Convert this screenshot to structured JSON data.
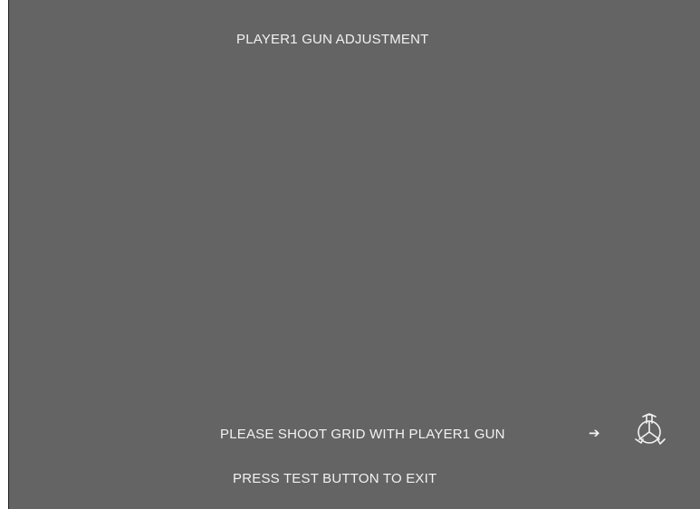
{
  "screen": {
    "title": "PLAYER1 GUN ADJUSTMENT",
    "instruction": "PLEASE SHOOT GRID WITH PLAYER1 GUN",
    "arrow": "➔",
    "exit_text": "PRESS TEST BUTTON TO EXIT",
    "icon": "gun-target-icon"
  },
  "colors": {
    "background": "#646464",
    "text": "#f2f2f2"
  }
}
